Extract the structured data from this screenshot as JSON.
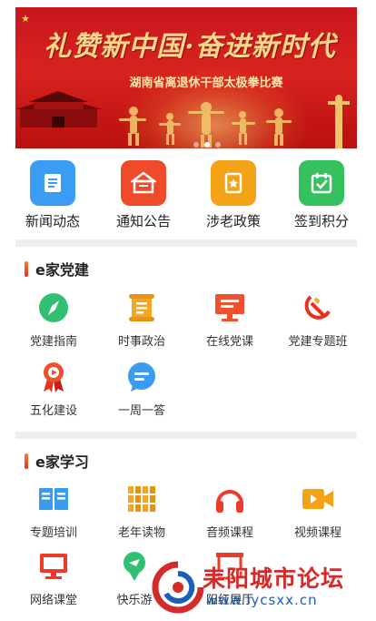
{
  "banner": {
    "headline": "礼赞新中国·奋进新时代",
    "subtitle": "湖南省离退休干部太极拳比赛",
    "slide_count": 3,
    "active_slide": 2
  },
  "quick_nav": [
    {
      "label": "新闻动态",
      "icon": "news-icon",
      "color": "#3b9cf3"
    },
    {
      "label": "通知公告",
      "icon": "notice-icon",
      "color": "#ef4a2a"
    },
    {
      "label": "涉老政策",
      "icon": "policy-icon",
      "color": "#f5a316"
    },
    {
      "label": "签到积分",
      "icon": "checkin-icon",
      "color": "#35c25e"
    }
  ],
  "party": {
    "title": "e家党建",
    "items": [
      {
        "label": "党建指南",
        "icon": "compass-icon"
      },
      {
        "label": "时事政治",
        "icon": "scroll-icon"
      },
      {
        "label": "在线党课",
        "icon": "monitor-icon"
      },
      {
        "label": "党建专题班",
        "icon": "hammer-sickle-icon"
      },
      {
        "label": "五化建设",
        "icon": "medal-icon"
      },
      {
        "label": "一周一答",
        "icon": "chat-bubble-icon"
      }
    ]
  },
  "study": {
    "title": "e家学习",
    "items": [
      {
        "label": "专题培训",
        "icon": "book-icon"
      },
      {
        "label": "老年读物",
        "icon": "bookshelf-icon"
      },
      {
        "label": "音频课程",
        "icon": "headphones-icon"
      },
      {
        "label": "视频课程",
        "icon": "video-camera-icon"
      },
      {
        "label": "网络课堂",
        "icon": "computer-icon"
      },
      {
        "label": "快乐游",
        "icon": "travel-icon"
      },
      {
        "label": "阳红展厅",
        "icon": "exhibition-icon"
      }
    ]
  },
  "watermark": {
    "title": "耒阳城市论坛",
    "url": "www.lycsxx.cn"
  },
  "colors": {
    "accent": "#e7301f",
    "banner_red": "#c8161d",
    "gold": "#f7d88b"
  }
}
